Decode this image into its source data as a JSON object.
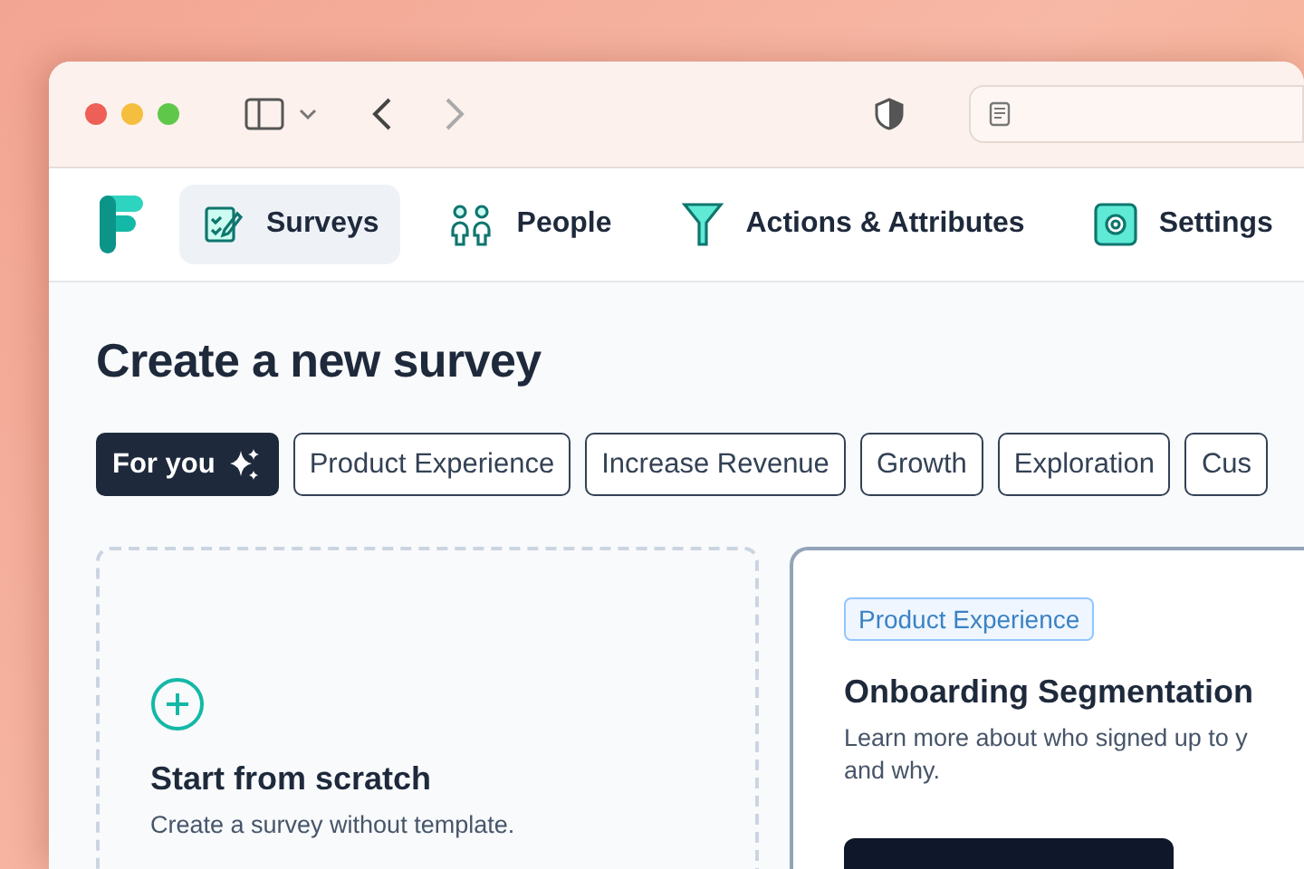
{
  "nav": {
    "items": [
      {
        "label": "Surveys",
        "selected": true
      },
      {
        "label": "People",
        "selected": false
      },
      {
        "label": "Actions & Attributes",
        "selected": false
      },
      {
        "label": "Settings",
        "selected": false
      }
    ]
  },
  "page": {
    "title": "Create a new survey"
  },
  "filters": [
    {
      "label": "For you",
      "kind": "featured",
      "selected": true
    },
    {
      "label": "Product Experience",
      "kind": "category",
      "selected": false
    },
    {
      "label": "Increase Revenue",
      "kind": "category",
      "selected": false
    },
    {
      "label": "Growth",
      "kind": "category",
      "selected": false
    },
    {
      "label": "Exploration",
      "kind": "category",
      "selected": false
    },
    {
      "label": "Cus",
      "kind": "category",
      "selected": false
    }
  ],
  "scratch_card": {
    "title": "Start from scratch",
    "description": "Create a survey without template."
  },
  "template_card": {
    "tag": "Product Experience",
    "title": "Onboarding Segmentation",
    "description_lines": [
      "Learn more about who signed up to y",
      "and why."
    ]
  }
}
